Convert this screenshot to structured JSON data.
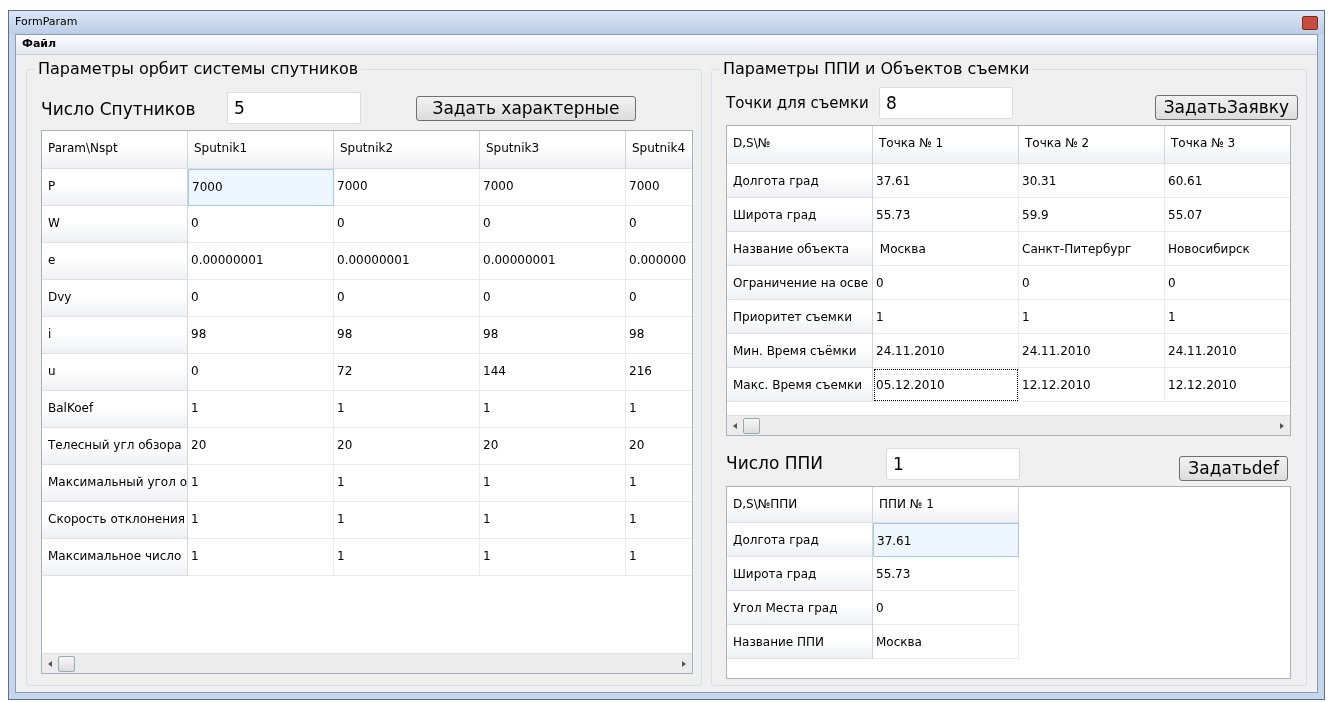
{
  "window": {
    "title": "FormParam"
  },
  "menu": [
    "Файл"
  ],
  "orbit_group": {
    "title": "Параметры орбит системы спутников",
    "count_label": "Число Спутников",
    "count_value": "5",
    "button": "Задать характерные",
    "table": {
      "corner": "Param\\Nspt",
      "columns": [
        "Sputnik1",
        "Sputnik2",
        "Sputnik3",
        "Sputnik4"
      ],
      "rows": [
        {
          "header": "P",
          "cells": [
            {
              "text": "7000",
              "selected": true
            },
            {
              "text": "7000",
              "selected": false
            },
            {
              "text": "7000",
              "selected": false
            },
            {
              "text": "7000",
              "selected": false
            }
          ]
        },
        {
          "header": "W",
          "cells": [
            {
              "text": "0",
              "selected": false
            },
            {
              "text": "0",
              "selected": false
            },
            {
              "text": "0",
              "selected": false
            },
            {
              "text": "0",
              "selected": false
            }
          ]
        },
        {
          "header": "e",
          "cells": [
            {
              "text": "0.00000001",
              "selected": false
            },
            {
              "text": "0.00000001",
              "selected": false
            },
            {
              "text": "0.00000001",
              "selected": false
            },
            {
              "text": "0.000000",
              "selected": false
            }
          ]
        },
        {
          "header": "Dvy",
          "cells": [
            {
              "text": "0",
              "selected": false
            },
            {
              "text": "0",
              "selected": false
            },
            {
              "text": "0",
              "selected": false
            },
            {
              "text": "0",
              "selected": false
            }
          ]
        },
        {
          "header": "i",
          "cells": [
            {
              "text": "98",
              "selected": false
            },
            {
              "text": "98",
              "selected": false
            },
            {
              "text": "98",
              "selected": false
            },
            {
              "text": "98",
              "selected": false
            }
          ]
        },
        {
          "header": "u",
          "cells": [
            {
              "text": "0",
              "selected": false
            },
            {
              "text": "72",
              "selected": false
            },
            {
              "text": "144",
              "selected": false
            },
            {
              "text": "216",
              "selected": false
            }
          ]
        },
        {
          "header": "BalKoef",
          "cells": [
            {
              "text": "1",
              "selected": false
            },
            {
              "text": "1",
              "selected": false
            },
            {
              "text": "1",
              "selected": false
            },
            {
              "text": "1",
              "selected": false
            }
          ]
        },
        {
          "header": "Телесный угл обзора",
          "cells": [
            {
              "text": "20",
              "selected": false
            },
            {
              "text": "20",
              "selected": false
            },
            {
              "text": "20",
              "selected": false
            },
            {
              "text": "20",
              "selected": false
            }
          ]
        },
        {
          "header": "Максимальный угол о",
          "cells": [
            {
              "text": "1",
              "selected": false
            },
            {
              "text": "1",
              "selected": false
            },
            {
              "text": "1",
              "selected": false
            },
            {
              "text": "1",
              "selected": false
            }
          ]
        },
        {
          "header": "Скорость отклонения",
          "cells": [
            {
              "text": "1",
              "selected": false
            },
            {
              "text": "1",
              "selected": false
            },
            {
              "text": "1",
              "selected": false
            },
            {
              "text": "1",
              "selected": false
            }
          ]
        },
        {
          "header": "Максимальное число",
          "cells": [
            {
              "text": "1",
              "selected": false
            },
            {
              "text": "1",
              "selected": false
            },
            {
              "text": "1",
              "selected": false
            },
            {
              "text": "1",
              "selected": false
            }
          ]
        }
      ]
    }
  },
  "objects_group": {
    "title": "Параметры ППИ и Объектов съемки",
    "points_label": "Точки для съемки",
    "points_value": "8",
    "points_button": "ЗадатьЗаявку",
    "points_table": {
      "corner": "D,S\\№",
      "columns": [
        "Точка № 1",
        "Точка № 2",
        "Точка № 3"
      ],
      "rows": [
        {
          "header": "Долгота град",
          "cells": [
            {
              "text": "37.61",
              "focused": false
            },
            {
              "text": "30.31",
              "focused": false
            },
            {
              "text": "60.61",
              "focused": false
            }
          ]
        },
        {
          "header": "Широта град",
          "cells": [
            {
              "text": "55.73",
              "focused": false
            },
            {
              "text": "59.9",
              "focused": false
            },
            {
              "text": "55.07",
              "focused": false
            }
          ]
        },
        {
          "header": "Название объекта",
          "cells": [
            {
              "text": " Москва",
              "focused": false
            },
            {
              "text": "Санкт-Питербург",
              "focused": false
            },
            {
              "text": "Новосибирск",
              "focused": false
            }
          ]
        },
        {
          "header": "Ограничение на осве",
          "cells": [
            {
              "text": "0",
              "focused": false
            },
            {
              "text": "0",
              "focused": false
            },
            {
              "text": "0",
              "focused": false
            }
          ]
        },
        {
          "header": "Приоритет съемки",
          "cells": [
            {
              "text": "1",
              "focused": false
            },
            {
              "text": "1",
              "focused": false
            },
            {
              "text": "1",
              "focused": false
            }
          ]
        },
        {
          "header": "Мин. Время съёмки",
          "cells": [
            {
              "text": "24.11.2010",
              "focused": false
            },
            {
              "text": "24.11.2010",
              "focused": false
            },
            {
              "text": "24.11.2010",
              "focused": false
            }
          ]
        },
        {
          "header": "Макс. Время съемки",
          "cells": [
            {
              "text": "05.12.2010",
              "focused": true
            },
            {
              "text": "12.12.2010",
              "focused": false
            },
            {
              "text": "12.12.2010",
              "focused": false
            }
          ]
        }
      ]
    },
    "ppi_label": "Число ППИ",
    "ppi_value": "1",
    "ppi_button": "Задатьdef",
    "ppi_table": {
      "corner": "D,S\\№ППИ",
      "columns": [
        "ППИ № 1"
      ],
      "rows": [
        {
          "header": "Долгота град",
          "cells": [
            {
              "text": "37.61",
              "selected": true
            }
          ]
        },
        {
          "header": "Широта град",
          "cells": [
            {
              "text": "55.73",
              "selected": false
            }
          ]
        },
        {
          "header": "Угол Места град",
          "cells": [
            {
              "text": "0",
              "selected": false
            }
          ]
        },
        {
          "header": "Название ППИ",
          "cells": [
            {
              "text": "Москва",
              "selected": false
            }
          ]
        }
      ]
    }
  }
}
